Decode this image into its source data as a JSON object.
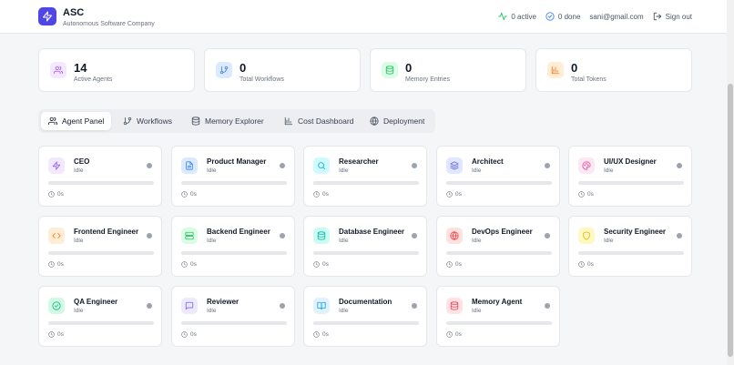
{
  "brand": {
    "title": "ASC",
    "subtitle": "Autonomous Software Company"
  },
  "header": {
    "active_label": "0 active",
    "done_label": "0 done",
    "email": "sani@gmail.com",
    "sign_out_label": "Sign out"
  },
  "stats": [
    {
      "value": "14",
      "label": "Active Agents",
      "icon": "users-icon",
      "color": "#a855f7",
      "bg": "#f3e8ff"
    },
    {
      "value": "0",
      "label": "Total Workflows",
      "icon": "git-branch-icon",
      "color": "#3b82f6",
      "bg": "#dbeafe"
    },
    {
      "value": "0",
      "label": "Memory Entries",
      "icon": "database-icon",
      "color": "#22c55e",
      "bg": "#dcfce7"
    },
    {
      "value": "0",
      "label": "Total Tokens",
      "icon": "bar-chart-icon",
      "color": "#f97316",
      "bg": "#ffedd5"
    }
  ],
  "tabs": [
    {
      "label": "Agent Panel",
      "icon": "users-icon",
      "active": true
    },
    {
      "label": "Workflows",
      "icon": "git-branch-icon"
    },
    {
      "label": "Memory Explorer",
      "icon": "database-icon"
    },
    {
      "label": "Cost Dashboard",
      "icon": "bar-chart-icon"
    },
    {
      "label": "Deployment",
      "icon": "globe-icon"
    }
  ],
  "agents": [
    {
      "name": "CEO",
      "status": "Idle",
      "time": "0s",
      "icon": "zap-icon",
      "color": "#8b5cf6",
      "bg": "#f3e8ff"
    },
    {
      "name": "Product Manager",
      "status": "Idle",
      "time": "0s",
      "icon": "file-text-icon",
      "color": "#3b82f6",
      "bg": "#dbeafe"
    },
    {
      "name": "Researcher",
      "status": "Idle",
      "time": "0s",
      "icon": "search-icon",
      "color": "#06b6d4",
      "bg": "#cffafe"
    },
    {
      "name": "Architect",
      "status": "Idle",
      "time": "0s",
      "icon": "layers-icon",
      "color": "#6366f1",
      "bg": "#e0e7ff"
    },
    {
      "name": "UI/UX Designer",
      "status": "Idle",
      "time": "0s",
      "icon": "palette-icon",
      "color": "#ec4899",
      "bg": "#fce7f3"
    },
    {
      "name": "Frontend Engineer",
      "status": "Idle",
      "time": "0s",
      "icon": "code-icon",
      "color": "#f97316",
      "bg": "#ffedd5"
    },
    {
      "name": "Backend Engineer",
      "status": "Idle",
      "time": "0s",
      "icon": "server-icon",
      "color": "#22c55e",
      "bg": "#dcfce7"
    },
    {
      "name": "Database Engineer",
      "status": "Idle",
      "time": "0s",
      "icon": "database-icon",
      "color": "#14b8a6",
      "bg": "#ccfbf1"
    },
    {
      "name": "DevOps Engineer",
      "status": "Idle",
      "time": "0s",
      "icon": "globe-icon",
      "color": "#ef4444",
      "bg": "#fee2e2"
    },
    {
      "name": "Security Engineer",
      "status": "Idle",
      "time": "0s",
      "icon": "shield-icon",
      "color": "#eab308",
      "bg": "#fef9c3"
    },
    {
      "name": "QA Engineer",
      "status": "Idle",
      "time": "0s",
      "icon": "check-circle-icon",
      "color": "#10b981",
      "bg": "#d1fae5"
    },
    {
      "name": "Reviewer",
      "status": "Idle",
      "time": "0s",
      "icon": "message-square-icon",
      "color": "#8b5cf6",
      "bg": "#ede9fe"
    },
    {
      "name": "Documentation",
      "status": "Idle",
      "time": "0s",
      "icon": "book-open-icon",
      "color": "#0ea5e9",
      "bg": "#e0f2fe"
    },
    {
      "name": "Memory Agent",
      "status": "Idle",
      "time": "0s",
      "icon": "database-icon",
      "color": "#f43f5e",
      "bg": "#ffe4e6"
    }
  ]
}
